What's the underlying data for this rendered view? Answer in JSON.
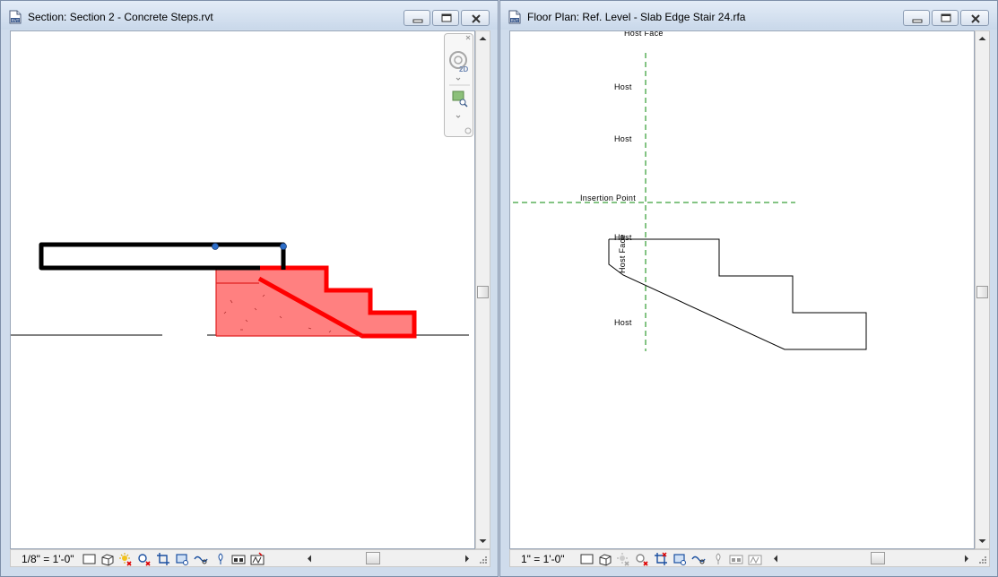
{
  "left_window": {
    "title": "Section: Section 2 - Concrete Steps.rvt",
    "doc_icon": "rvt-file-icon",
    "scale": "1/8\" = 1'-0\"",
    "nav_wheel_label": "2D"
  },
  "right_window": {
    "title": "Floor Plan: Ref. Level - Slab Edge Stair 24.rfa",
    "doc_icon": "rvt-file-icon",
    "scale": "1\" = 1'-0\"",
    "annotations": {
      "host_face_top": "Host Face",
      "host_1": "Host",
      "host_2": "Host",
      "insertion_point": "Insertion Point",
      "host_3": "Host",
      "host_face_vertical": "Host Face",
      "host_4": "Host"
    }
  },
  "icon_text": {
    "doc_icon_label": "RVT"
  },
  "colors": {
    "stair_fill": "#ff8080",
    "stair_outline": "#ff0000",
    "slab_outline": "#000000",
    "grip": "#2d6ec9",
    "reference_line": "#0a8a0a"
  }
}
